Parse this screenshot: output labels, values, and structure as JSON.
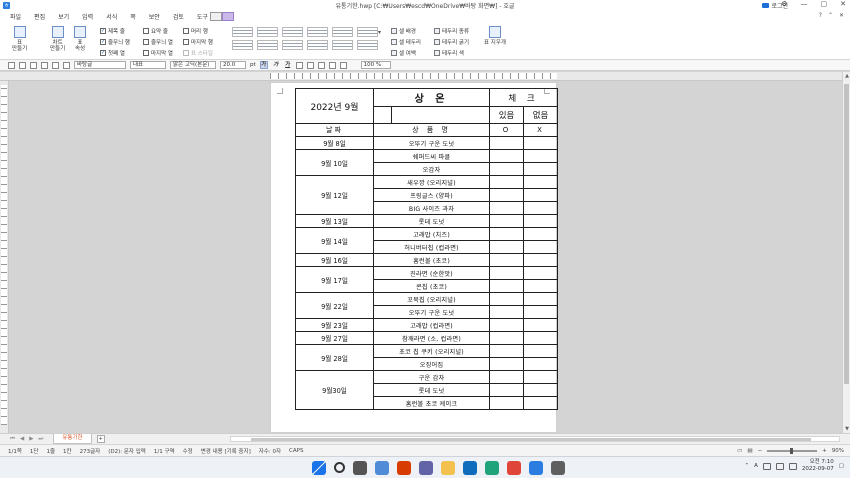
{
  "titlebar": {
    "title": "유통기한.hwp [C:₩Users₩escd₩OneDrive₩바탕 화면₩] - 호글",
    "login": "로그인",
    "controls": [
      "⚙",
      "—",
      "▢",
      "✕"
    ]
  },
  "menu": {
    "items": [
      "파일",
      "편집",
      "보기",
      "입력",
      "서식",
      "쪽",
      "보안",
      "검토",
      "도구"
    ],
    "right": [
      "?",
      "⌃",
      "✕"
    ]
  },
  "ribbon": {
    "groups": [
      {
        "label": "표\n만들기"
      },
      {
        "label": "차트\n만들기"
      },
      {
        "label": "표\n속성"
      },
      {
        "label": "표\n디자인"
      }
    ],
    "checks_col1": [
      {
        "label": "제목 줄",
        "checked": true
      },
      {
        "label": "줄무늬 행",
        "checked": true
      },
      {
        "label": "첫째 열",
        "checked": true
      }
    ],
    "checks_col2": [
      {
        "label": "요약 줄",
        "checked": false
      },
      {
        "label": "줄무늬 열",
        "checked": false
      },
      {
        "label": "마지막 열",
        "checked": false
      }
    ],
    "checks_col3": [
      {
        "label": "머리 행",
        "checked": false
      },
      {
        "label": "마지막 행",
        "checked": false
      },
      {
        "label": "표 스타일",
        "checked": false
      }
    ],
    "list1": [
      "셀 배경",
      "셀 테두리",
      "셀 여백"
    ],
    "list2": [
      "테두리 종류",
      "테두리 굵기",
      "테두리 색"
    ],
    "last_group": "표 지우개"
  },
  "toolbar": {
    "style": "바탕글",
    "lang": "대표",
    "font": "맑은 고딕(본문)",
    "size": "20.0",
    "unit": "pt",
    "bold": "가",
    "italic": "가",
    "underline": "가",
    "zoom": "100 %"
  },
  "table": {
    "header_date": "2022년 9월",
    "header_main": "상 온",
    "header_check": "체 크",
    "col_have": "있음",
    "col_none": "없음",
    "col_date": "날짜",
    "col_product": "상 품 명",
    "mark_o": "O",
    "mark_x": "X",
    "groups": [
      {
        "date": "9월 8일",
        "products": [
          "오뚜기 구운 도넛"
        ]
      },
      {
        "date": "9월 10일",
        "products": [
          "쉐퍼드씨 파클",
          "오감자"
        ]
      },
      {
        "date": "9월 12일",
        "products": [
          "새우깡 (오리지널)",
          "프링글스 (양파)",
          "BIG 사이즈 과자"
        ]
      },
      {
        "date": "9월 13일",
        "products": [
          "롯데 도넛"
        ]
      },
      {
        "date": "9월 14일",
        "products": [
          "고래밥 (치즈)",
          "허니버터칩 (컵라면)"
        ]
      },
      {
        "date": "9월 16일",
        "products": [
          "홈런볼 (초코)"
        ]
      },
      {
        "date": "9월 17일",
        "products": [
          "진라면 (순한맛)",
          "콘칩 (초코)"
        ]
      },
      {
        "date": "9월 22일",
        "products": [
          "꼬북칩 (오리지널)",
          "오뚜기 구운 도넛"
        ]
      },
      {
        "date": "9월 23일",
        "products": [
          "고래밥 (컵라면)"
        ]
      },
      {
        "date": "9월 27일",
        "products": [
          "참깨라면 (소, 컵라면)"
        ]
      },
      {
        "date": "9월 28일",
        "products": [
          "초코 칩 쿠키 (오리지널)",
          "오징어집"
        ]
      },
      {
        "date": "9월30일",
        "products": [
          "구운 감자",
          "롯데 도넛",
          "홈런볼 초코 케이크"
        ]
      }
    ]
  },
  "bottombar": {
    "sheet_tab": "유통기한",
    "add": "+"
  },
  "status": {
    "items": [
      "1/1쪽",
      "1단",
      "1줄",
      "1칸",
      "273글자",
      "(D2): 문자 입력",
      "1/1 구역",
      "수정",
      "변경 내용 [기록 중지]",
      "자수: 0자",
      "CAPS"
    ],
    "zoom": "90%"
  },
  "taskbar": {
    "time": "오전 7:10",
    "date": "2022-09-07",
    "lang": "A",
    "icons": [
      "windows-icon",
      "search-icon",
      "task-view-icon",
      "widgets-icon",
      "office-icon",
      "chat-icon",
      "explorer-icon",
      "mail-icon",
      "edge-icon",
      "chrome-icon",
      "hangul-icon",
      "store-icon"
    ],
    "icon_colors": [
      "#1a73e8",
      "#333333",
      "#555555",
      "#4f8bd6",
      "#d83b01",
      "#6264a7",
      "#f2c14e",
      "#0f6cbd",
      "#1fa37a",
      "#e0453a",
      "#2b7de0",
      "#5f5f5f"
    ]
  }
}
